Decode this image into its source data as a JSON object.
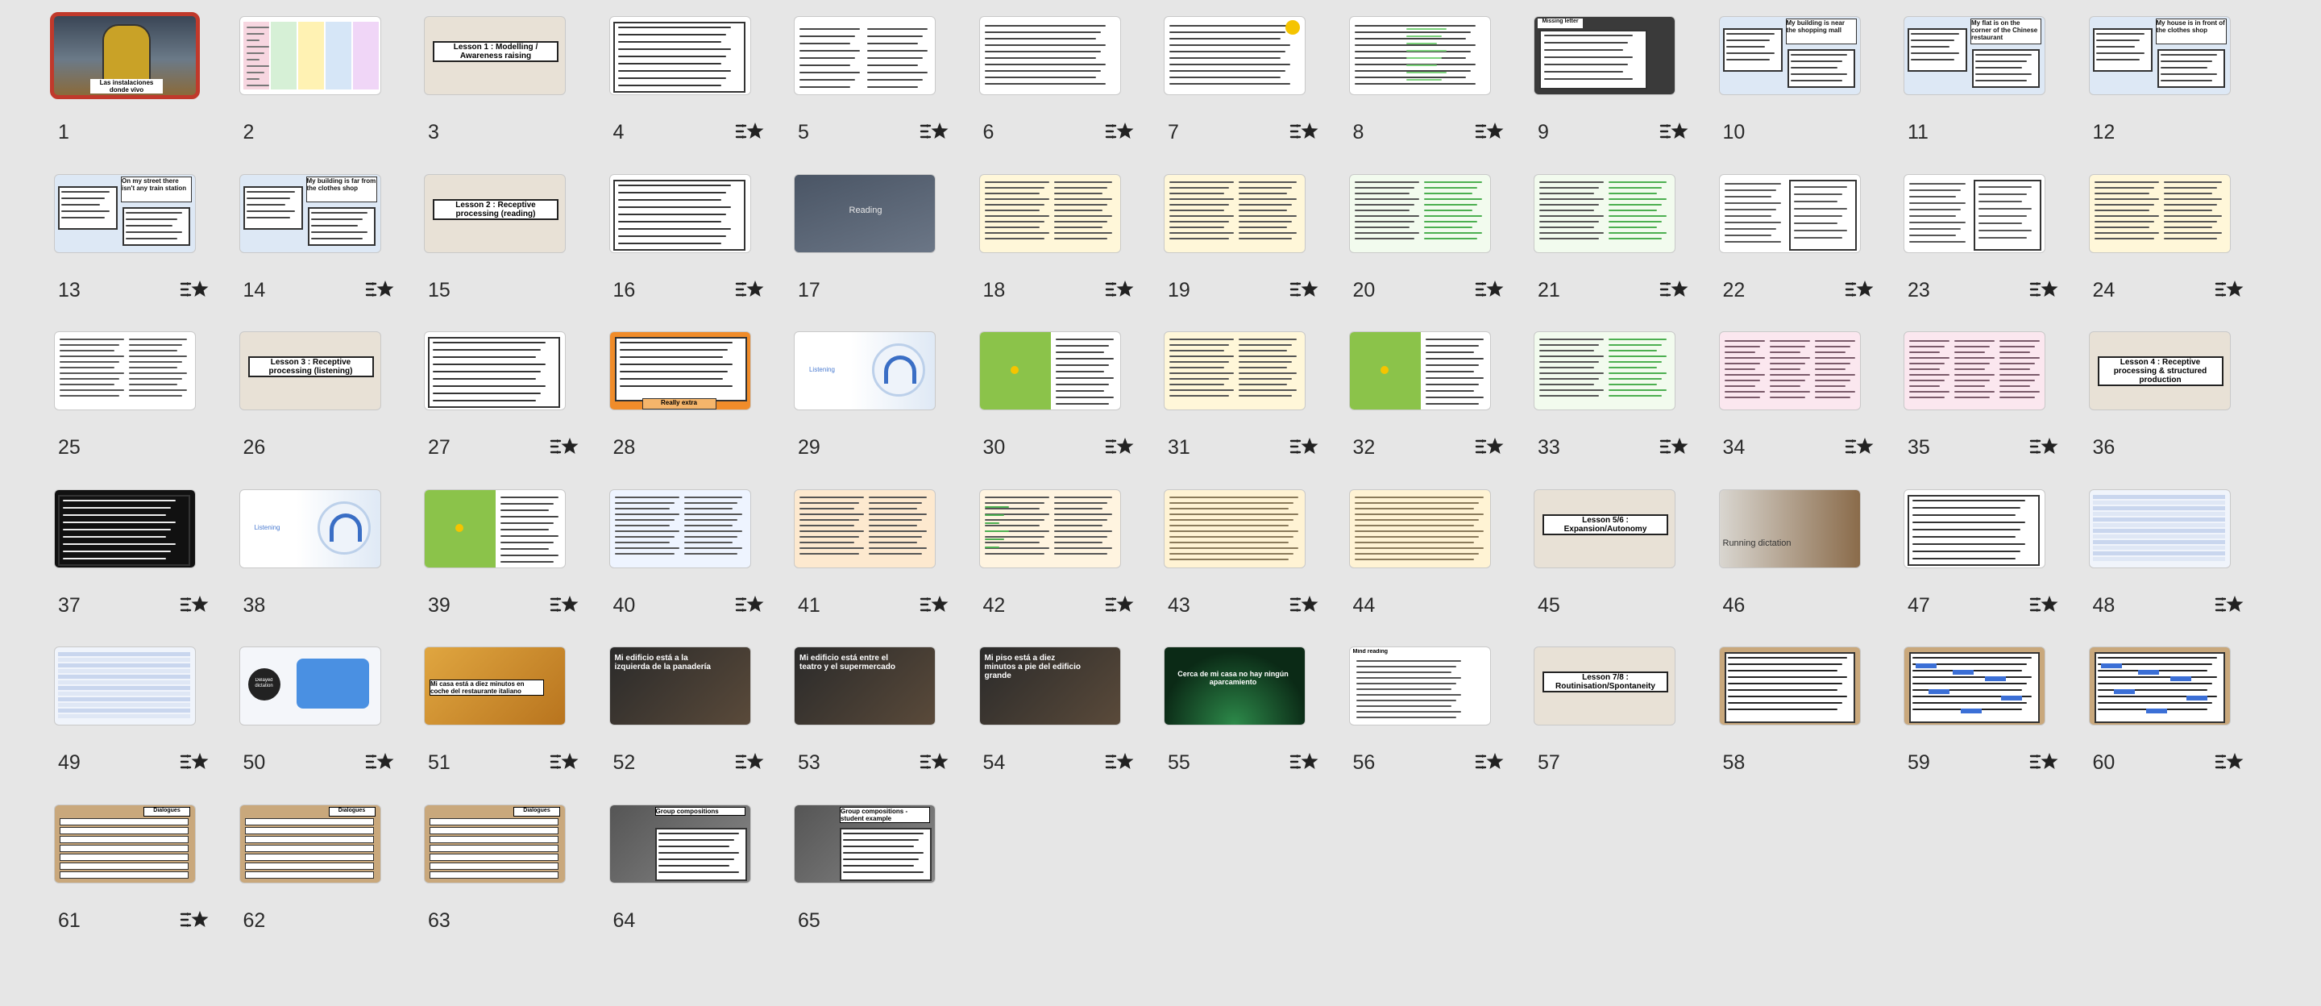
{
  "app": {
    "view": "slide-grid",
    "selected_slide": 1
  },
  "colors": {
    "background": "#e6e6e6",
    "selection_border": "#c0392b",
    "lesson_beige": "#e8e1d6",
    "green": "#8bc34a",
    "orange": "#f08c2a",
    "dark": "#2b2b2b",
    "cork": "#c9a87c",
    "blue_highlight": "#3b6fd6"
  },
  "transition_icon": "transition-star-icon",
  "slides": [
    {
      "n": "1",
      "kind": "photo-hero",
      "caption": "Las instalaciones\ndonde vivo",
      "transition": false
    },
    {
      "n": "2",
      "kind": "colorful-table",
      "caption": "",
      "transition": false
    },
    {
      "n": "3",
      "kind": "lesson",
      "caption": "Lesson 1 : Modelling / Awareness raising",
      "transition": false
    },
    {
      "n": "4",
      "kind": "list",
      "caption": "",
      "transition": true
    },
    {
      "n": "5",
      "kind": "two-col-list",
      "caption": "",
      "transition": true
    },
    {
      "n": "6",
      "kind": "worksheet",
      "caption": "",
      "transition": true
    },
    {
      "n": "7",
      "kind": "list-sun",
      "caption": "",
      "transition": true
    },
    {
      "n": "8",
      "kind": "list-green",
      "caption": "",
      "transition": true
    },
    {
      "n": "9",
      "kind": "dark-worksheet",
      "caption": "Missing letter",
      "transition": true
    },
    {
      "n": "10",
      "kind": "speech-blue",
      "caption": "My building is near the shopping mall",
      "transition": false
    },
    {
      "n": "11",
      "kind": "speech-blue",
      "caption": "My flat is on the corner of the Chinese restaurant",
      "transition": false
    },
    {
      "n": "12",
      "kind": "speech-blue",
      "caption": "My house is in front of the clothes shop",
      "transition": false
    },
    {
      "n": "13",
      "kind": "speech-blue",
      "caption": "On my street there isn't any train station",
      "transition": true
    },
    {
      "n": "14",
      "kind": "speech-blue",
      "caption": "My building is far from the clothes shop",
      "transition": true
    },
    {
      "n": "15",
      "kind": "lesson",
      "caption": "Lesson 2 : Receptive processing (reading)",
      "transition": false
    },
    {
      "n": "16",
      "kind": "list",
      "caption": "",
      "transition": true
    },
    {
      "n": "17",
      "kind": "reading",
      "caption": "Reading",
      "transition": false
    },
    {
      "n": "18",
      "kind": "text-yellow",
      "caption": "",
      "transition": true
    },
    {
      "n": "19",
      "kind": "text-yellow",
      "caption": "",
      "transition": true
    },
    {
      "n": "20",
      "kind": "text-green",
      "caption": "",
      "transition": true
    },
    {
      "n": "21",
      "kind": "text-green",
      "caption": "",
      "transition": true
    },
    {
      "n": "22",
      "kind": "questions",
      "caption": "",
      "transition": true
    },
    {
      "n": "23",
      "kind": "questions",
      "caption": "",
      "transition": true
    },
    {
      "n": "24",
      "kind": "text-yellow",
      "caption": "",
      "transition": true
    },
    {
      "n": "25",
      "kind": "text-two",
      "caption": "",
      "transition": false
    },
    {
      "n": "26",
      "kind": "lesson",
      "caption": "Lesson 3 : Receptive processing (listening)",
      "transition": false
    },
    {
      "n": "27",
      "kind": "list",
      "caption": "",
      "transition": true
    },
    {
      "n": "28",
      "kind": "orange-list",
      "caption": "Really extra",
      "transition": false
    },
    {
      "n": "29",
      "kind": "listening",
      "caption": "Listening",
      "transition": false
    },
    {
      "n": "30",
      "kind": "green-audio",
      "caption": "",
      "transition": true
    },
    {
      "n": "31",
      "kind": "text-yellow",
      "caption": "",
      "transition": true
    },
    {
      "n": "32",
      "kind": "green-audio",
      "caption": "",
      "transition": true
    },
    {
      "n": "33",
      "kind": "text-green",
      "caption": "",
      "transition": true
    },
    {
      "n": "34",
      "kind": "pink-text",
      "caption": "",
      "transition": true
    },
    {
      "n": "35",
      "kind": "pink-text",
      "caption": "",
      "transition": true
    },
    {
      "n": "36",
      "kind": "lesson",
      "caption": "Lesson 4 : Receptive processing & structured production",
      "transition": false
    },
    {
      "n": "37",
      "kind": "black-list",
      "caption": "",
      "transition": true
    },
    {
      "n": "38",
      "kind": "listening",
      "caption": "Listening",
      "transition": false
    },
    {
      "n": "39",
      "kind": "green-audio",
      "caption": "",
      "transition": true
    },
    {
      "n": "40",
      "kind": "text-blue",
      "caption": "",
      "transition": true
    },
    {
      "n": "41",
      "kind": "text-orange",
      "caption": "",
      "transition": true
    },
    {
      "n": "42",
      "kind": "text-highlight",
      "caption": "",
      "transition": true
    },
    {
      "n": "43",
      "kind": "table-yellow",
      "caption": "",
      "transition": true
    },
    {
      "n": "44",
      "kind": "table-yellow",
      "caption": "",
      "transition": false
    },
    {
      "n": "45",
      "kind": "lesson",
      "caption": "Lesson 5/6 : Expansion/Autonomy",
      "transition": false
    },
    {
      "n": "46",
      "kind": "running",
      "caption": "Running dictation",
      "transition": false
    },
    {
      "n": "47",
      "kind": "list",
      "caption": "",
      "transition": true
    },
    {
      "n": "48",
      "kind": "table-blue",
      "caption": "",
      "transition": true
    },
    {
      "n": "49",
      "kind": "table-blue",
      "caption": "",
      "transition": true
    },
    {
      "n": "50",
      "kind": "delayed",
      "caption": "Delayed dictation",
      "transition": true
    },
    {
      "n": "51",
      "kind": "food-photo",
      "caption": "Mi casa está a diez minutos en coche del restaurante italiano",
      "transition": true
    },
    {
      "n": "52",
      "kind": "dark-photo",
      "caption": "Mi edificio está a la izquierda de la panadería",
      "transition": true
    },
    {
      "n": "53",
      "kind": "dark-photo",
      "caption": "Mi edificio está entre el teatro y el supermercado",
      "transition": true
    },
    {
      "n": "54",
      "kind": "dark-photo",
      "caption": "Mi piso está a diez minutos a pie del edificio grande",
      "transition": true
    },
    {
      "n": "55",
      "kind": "green-lights",
      "caption": "Cerca de mi casa no hay ningún aparcamiento",
      "transition": true
    },
    {
      "n": "56",
      "kind": "mind-reading",
      "caption": "Mind reading",
      "transition": true
    },
    {
      "n": "57",
      "kind": "lesson",
      "caption": "Lesson 7/8 : Routinisation/Spontaneity",
      "transition": false
    },
    {
      "n": "58",
      "kind": "cork",
      "caption": "",
      "transition": false
    },
    {
      "n": "59",
      "kind": "cork-blue",
      "caption": "",
      "transition": true
    },
    {
      "n": "60",
      "kind": "cork-blue",
      "caption": "",
      "transition": true
    },
    {
      "n": "61",
      "kind": "dialogue",
      "caption": "Dialogues",
      "transition": true
    },
    {
      "n": "62",
      "kind": "dialogue",
      "caption": "Dialogues",
      "transition": false
    },
    {
      "n": "63",
      "kind": "dialogue",
      "caption": "Dialogues",
      "transition": false
    },
    {
      "n": "64",
      "kind": "group",
      "caption": "Group compositions",
      "transition": false
    },
    {
      "n": "65",
      "kind": "group",
      "caption": "Group compositions - student example",
      "transition": false
    }
  ]
}
